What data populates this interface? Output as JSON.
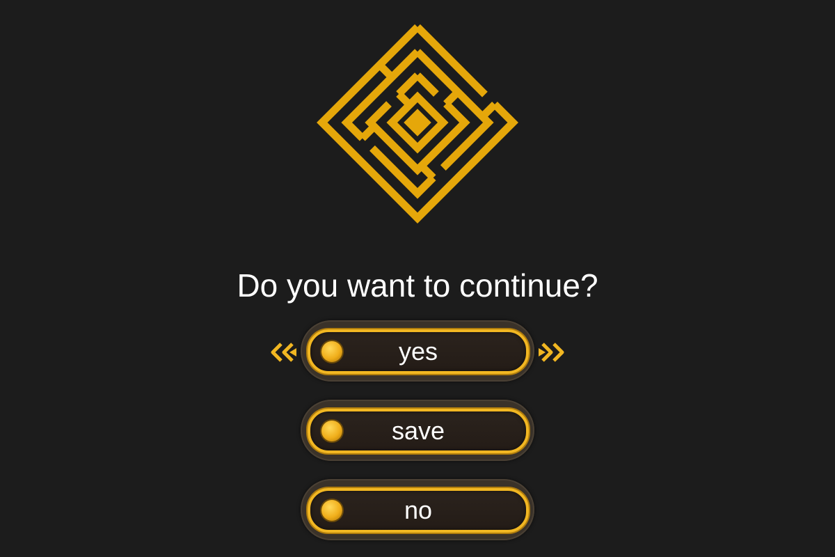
{
  "dialog": {
    "question": "Do you want to continue?",
    "options": [
      {
        "label": "yes",
        "selected": true
      },
      {
        "label": "save",
        "selected": false
      },
      {
        "label": "no",
        "selected": false
      }
    ]
  },
  "icons": {
    "logo": "maze-diamond-icon",
    "selector_left": "double-chevron-left-icon",
    "selector_right": "double-chevron-right-icon",
    "option_bullet": "gold-dot-icon"
  },
  "colors": {
    "background": "#1c1c1c",
    "gold": "#e5a70a",
    "button_border": "#f2b722",
    "button_fill": "#2b231d",
    "text": "#ffffff"
  }
}
